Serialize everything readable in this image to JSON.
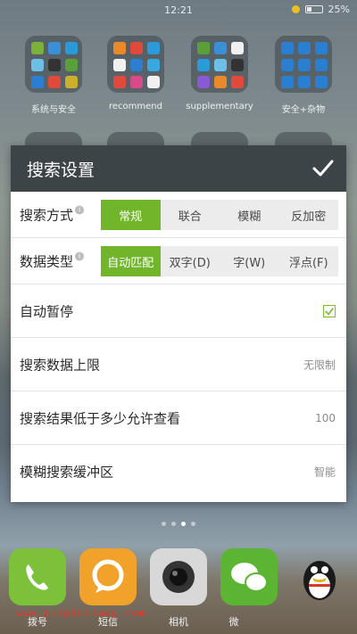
{
  "status_bar": {
    "time": "12:21",
    "battery": "25%"
  },
  "folders_row1": [
    "系统与安全",
    "recommend",
    "supplementary",
    "安全+杂物"
  ],
  "dialog": {
    "title": "搜索设置",
    "rows": {
      "search_mode": {
        "label": "搜索方式",
        "options": [
          "常规",
          "联合",
          "模糊",
          "反加密"
        ],
        "selected": "常规"
      },
      "data_type": {
        "label": "数据类型",
        "options": [
          "自动匹配",
          "双字(D)",
          "字(W)",
          "浮点(F)"
        ],
        "selected": "自动匹配"
      },
      "auto_pause": {
        "label": "自动暂停",
        "checked": true
      },
      "search_limit": {
        "label": "搜索数据上限",
        "value": "无限制"
      },
      "result_threshold": {
        "label": "搜索结果低于多少允许查看",
        "value": "100"
      },
      "fuzzy_buffer": {
        "label": "模糊搜索缓冲区",
        "value": "智能"
      }
    }
  },
  "dock": {
    "labels": [
      "拨号",
      "短信",
      "相机",
      "微"
    ]
  },
  "watermark": "www.pinpinchang.com",
  "colors": {
    "accent": "#71b62a",
    "header": "#3d4448"
  }
}
